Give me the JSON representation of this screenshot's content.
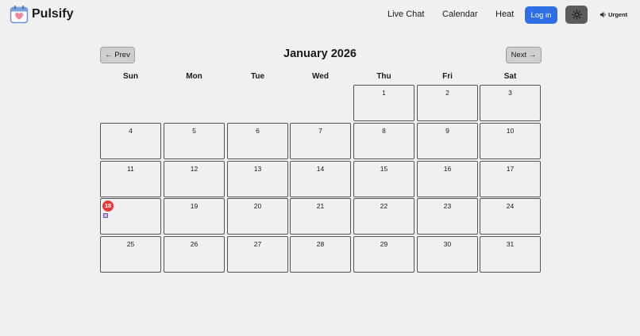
{
  "app": {
    "name": "Pulsify",
    "logo_icon": "calendar-heart-icon"
  },
  "nav": {
    "live_chat": "Live Chat",
    "calendar": "Calendar",
    "heat": "Heat",
    "login": "Log in",
    "theme_icon": "sun-icon",
    "urgent": "Urgent",
    "urgent_icon": "speaker-icon"
  },
  "calendar": {
    "prev_label": "← Prev",
    "next_label": "Next →",
    "month_title": "January 2026",
    "weekdays": [
      "Sun",
      "Mon",
      "Tue",
      "Wed",
      "Thu",
      "Fri",
      "Sat"
    ],
    "days": [
      "1",
      "2",
      "3",
      "4",
      "5",
      "6",
      "7",
      "8",
      "9",
      "10",
      "11",
      "12",
      "13",
      "14",
      "15",
      "16",
      "17",
      "18",
      "19",
      "20",
      "21",
      "22",
      "23",
      "24",
      "25",
      "26",
      "27",
      "28",
      "29",
      "30",
      "31"
    ],
    "first_weekday_index": 4,
    "today": "18",
    "event_days": [
      "18"
    ]
  },
  "colors": {
    "accent": "#2f6fe6",
    "today": "#e33b3b",
    "event": "#cdb6ea",
    "theme_button": "#5c5c5c"
  }
}
